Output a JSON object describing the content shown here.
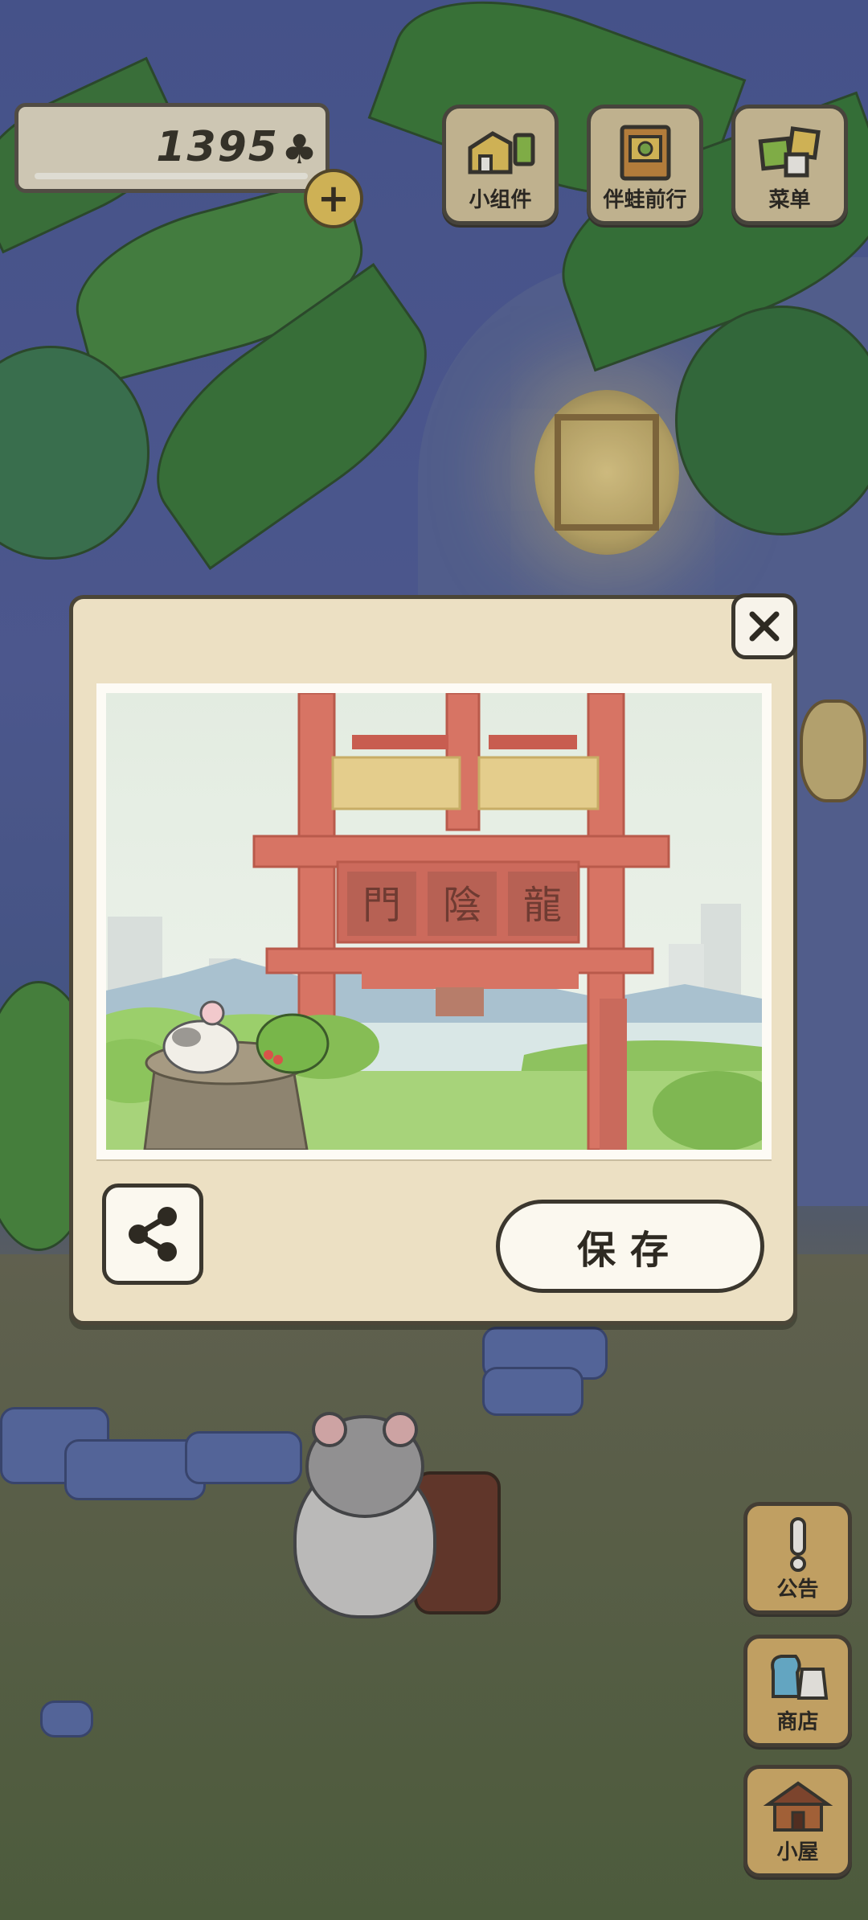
{
  "hud": {
    "clover_count": "1395",
    "clover_symbol": "♣",
    "add_symbol": "+"
  },
  "top_menu": [
    {
      "label": "小组件",
      "icon": "widget-icon"
    },
    {
      "label": "伴蛙前行",
      "icon": "frog-journey-icon"
    },
    {
      "label": "菜单",
      "icon": "menu-icon"
    }
  ],
  "side_menu": [
    {
      "label": "公告",
      "icon": "notice-icon"
    },
    {
      "label": "商店",
      "icon": "shop-icon"
    },
    {
      "label": "小屋",
      "icon": "house-icon"
    }
  ],
  "photo_dialog": {
    "close_symbol": "✕",
    "save_label": "保存",
    "sign_characters": [
      "門",
      "陰",
      "龍"
    ]
  },
  "colors": {
    "panel_bg": "#ece0c3",
    "border": "#4b4638",
    "side_button": "#d9b26a",
    "top_button": "#d8c79d",
    "gate_red": "#cf6b5e"
  }
}
